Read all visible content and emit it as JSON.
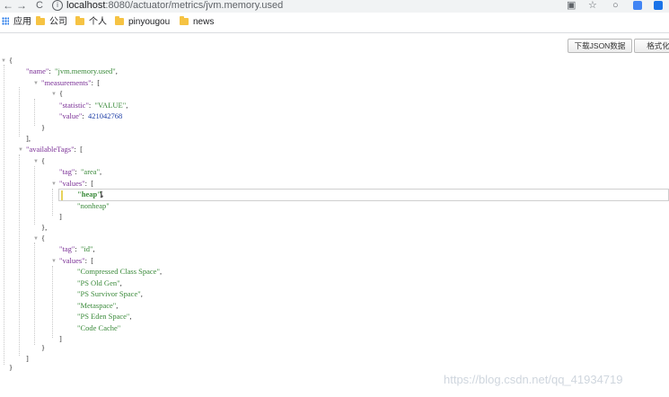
{
  "browser": {
    "back": "←",
    "forward": "→",
    "reload": "C",
    "info": "i",
    "url_host": "localhost",
    "url_path": ":8080/actuator/metrics/jvm.memory.used",
    "icons": {
      "translate": "translate-icon",
      "star": "☆",
      "circle": "○"
    }
  },
  "bookmarks": [
    {
      "label": "应用",
      "icon": "apps-grid-icon"
    },
    {
      "label": "公司",
      "icon": "folder-icon"
    },
    {
      "label": "个人",
      "icon": "folder-icon"
    },
    {
      "label": "pinyougou",
      "icon": "folder-icon"
    },
    {
      "label": "news",
      "icon": "folder-icon"
    }
  ],
  "buttons": {
    "download": "下载JSON数据",
    "format": "格式化"
  },
  "json_lines": [
    {
      "t": "{"
    },
    {
      "k": "\"name\"",
      "s": "\"jvm.memory.used\"",
      "p": ","
    },
    {
      "k": "\"measurements\"",
      "b": "["
    },
    {
      "t": "{"
    },
    {
      "k": "\"statistic\"",
      "s": "\"VALUE\"",
      "p": ","
    },
    {
      "k": "\"value\"",
      "n": "421042768"
    },
    {
      "t": "}"
    },
    {
      "t": "],"
    },
    {
      "k": "\"availableTags\"",
      "b": "["
    },
    {
      "t": "{"
    },
    {
      "k": "\"tag\"",
      "s": "\"area\"",
      "p": ","
    },
    {
      "k": "\"values\"",
      "b": "["
    },
    {
      "s": "\"heap\"",
      "p": ","
    },
    {
      "s": "\"nonheap\""
    },
    {
      "t": "]"
    },
    {
      "t": "},"
    },
    {
      "t": "{"
    },
    {
      "k": "\"tag\"",
      "s": "\"id\"",
      "p": ","
    },
    {
      "k": "\"values\"",
      "b": "["
    },
    {
      "s": "\"Compressed Class Space\"",
      "p": ","
    },
    {
      "s": "\"PS Old Gen\"",
      "p": ","
    },
    {
      "s": "\"PS Survivor Space\"",
      "p": ","
    },
    {
      "s": "\"Metaspace\"",
      "p": ","
    },
    {
      "s": "\"PS Eden Space\"",
      "p": ","
    },
    {
      "s": "\"Code Cache\""
    },
    {
      "t": "]"
    },
    {
      "t": "}"
    },
    {
      "t": "]"
    },
    {
      "t": "}"
    }
  ],
  "watermark": "https://blog.csdn.net/qq_41934719"
}
